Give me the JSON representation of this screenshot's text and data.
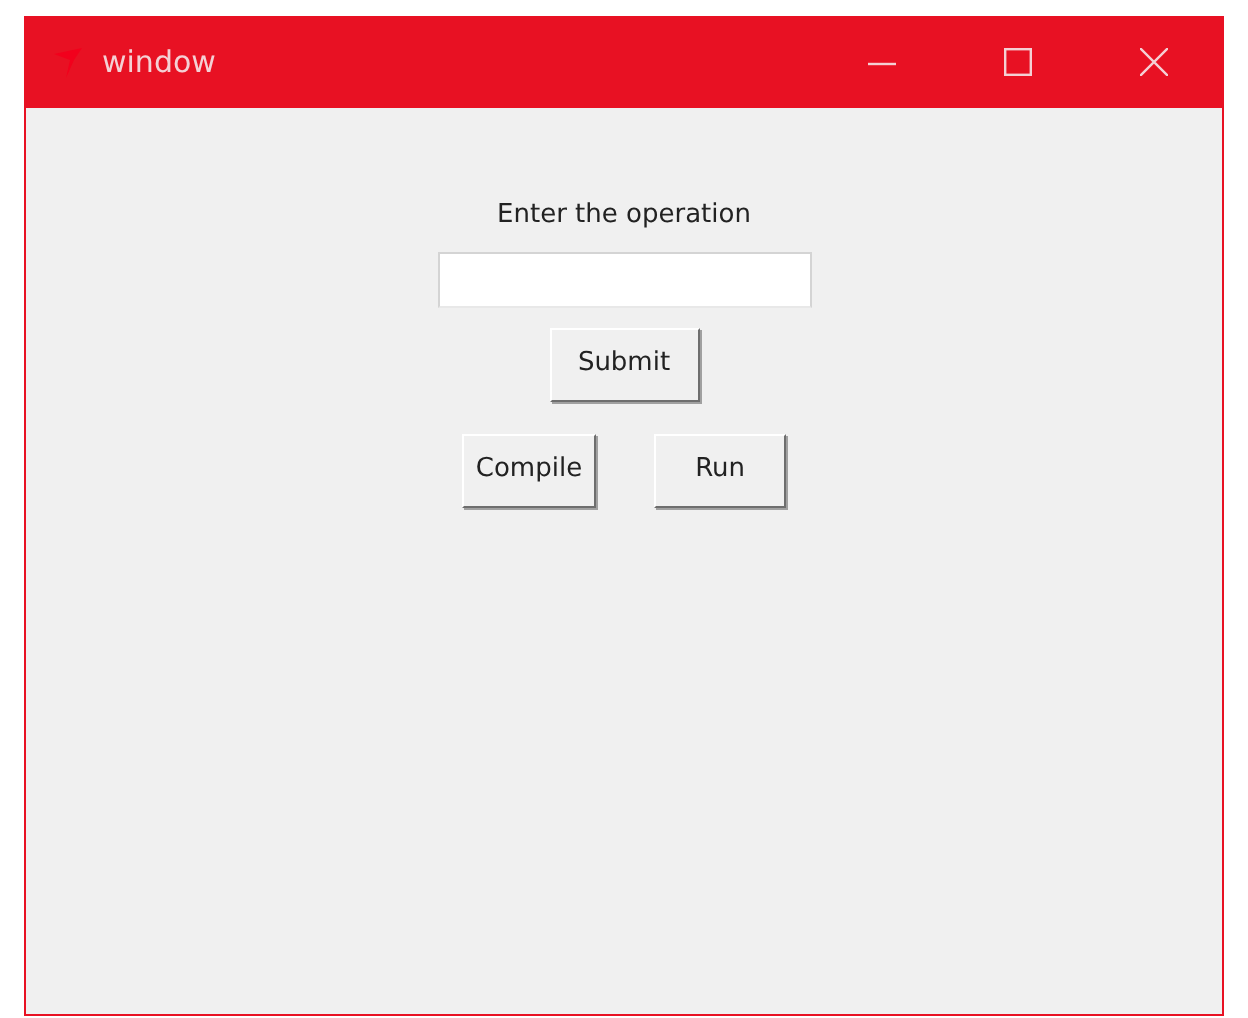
{
  "window": {
    "title": "window"
  },
  "label": "Enter the operation",
  "submit_button": "Submit",
  "buttons": [
    "Compile",
    "Run"
  ]
}
